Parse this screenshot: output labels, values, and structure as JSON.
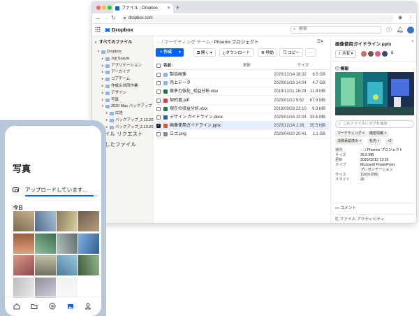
{
  "browser": {
    "tab_title": "ファイル - Dropbox",
    "new_tab": "+",
    "url": "dropbox.com"
  },
  "app": {
    "logo": "Dropbox",
    "search_placeholder": "検索"
  },
  "sidebar": {
    "all_files": "すべてのファイル",
    "items": [
      {
        "label": "Dropbox",
        "depth": 1,
        "expanded": true
      },
      {
        "label": "Joji Suzuki",
        "depth": 2
      },
      {
        "label": "アプリケーション",
        "depth": 2
      },
      {
        "label": "アーカイブ",
        "depth": 2
      },
      {
        "label": "コアチーム",
        "depth": 2
      },
      {
        "label": "作成＆共同作業",
        "depth": 2
      },
      {
        "label": "デザイン",
        "depth": 2
      },
      {
        "label": "写真",
        "depth": 2
      },
      {
        "label": "2020 Mac バックアップ",
        "depth": 2,
        "expanded": true
      },
      {
        "label": "広告",
        "depth": 3
      },
      {
        "label": "バックアップ_2.13.20",
        "depth": 3
      },
      {
        "label": "バックアップ_2.13.20",
        "depth": 3
      }
    ]
  },
  "breadcrumb": {
    "ellipsis": "···",
    "parent": "/ マーケティング チーム /",
    "current": "Phoenix プロジェクト"
  },
  "toolbar": {
    "create": "+ 作成",
    "open": "開く",
    "download": "ダウンロード",
    "move": "移動",
    "copy": "コピー",
    "more": "···"
  },
  "table": {
    "headers": {
      "name": "名前 ↑",
      "modified": "更新",
      "size": "サイズ"
    },
    "rows": [
      {
        "name": "製品画像",
        "modified": "2020/12/14 18:22",
        "size": "8.5 GB",
        "type": "folder",
        "selected": false
      },
      {
        "name": "売上データ",
        "modified": "2020/01/16 14:04",
        "size": "4.7 GB",
        "type": "folder",
        "selected": false
      },
      {
        "name": "競争力強化_収益分析.xlsx",
        "modified": "2019/12/11 16:29",
        "size": "11.8 MB",
        "type": "xlsx",
        "selected": false
      },
      {
        "name": "契約書.pdf",
        "modified": "2020/01/12 9:52",
        "size": "67.9 MB",
        "type": "pdf",
        "selected": false
      },
      {
        "name": "現在の収益分析.xlsx",
        "modified": "2019/09/28 23:10",
        "size": "9.3 MB",
        "type": "xlsx",
        "selected": false
      },
      {
        "name": "デザイン ガイドライン.docx",
        "modified": "2020/01/16 12:04",
        "size": "33.6 MB",
        "type": "docx",
        "selected": false
      },
      {
        "name": "画像使用ガイドライン.pptx",
        "modified": "2020/12/14 1:26",
        "size": "35.5 MB",
        "type": "pptx",
        "selected": true
      },
      {
        "name": "ロゴ.png",
        "modified": "2020/04/20 20:41",
        "size": "2.1 GB",
        "type": "png",
        "selected": false
      }
    ]
  },
  "details": {
    "title": "画像使用ガイドライン.pptx",
    "close": "×",
    "share": "共有",
    "member_count": "6",
    "info_heading": "情報",
    "tag_placeholder": "このファイルにタグを追加",
    "tags": [
      "マーケティング ×",
      "機密情報 ×",
      "法務承認済み ×",
      "社内 ×",
      "+2"
    ],
    "info": [
      {
        "k": "場所",
        "v": "··· / Phoenix プロジェクト"
      },
      {
        "k": "サイズ",
        "v": "35.5 MB"
      },
      {
        "k": "更新",
        "v": "2020/02/12 13:26"
      },
      {
        "k": "タイプ",
        "v": "Microsoft PowerPoint"
      },
      {
        "k": "",
        "v": "プレゼンテーション"
      },
      {
        "k": "サイズ",
        "v": "1920x1080"
      },
      {
        "k": "スライド",
        "v": "26"
      }
    ],
    "comment": "コメント",
    "activity": "ファイル アクティビティ"
  },
  "phone": {
    "behind_text_1": "イル リクエスト",
    "behind_text_2": "したファイル",
    "title": "写真",
    "upload_label": "アップロードしています...",
    "upload_progress": 0.93,
    "section_today": "今日",
    "nav": [
      "home-icon",
      "folder-icon",
      "plus-icon",
      "photos-icon",
      "account-icon"
    ]
  },
  "colors": {
    "accent": "#0061fe",
    "phone_frame": "#b6c7dc",
    "selected_row": "#e6efff",
    "sidebar_bg": "#f7f5f2"
  }
}
